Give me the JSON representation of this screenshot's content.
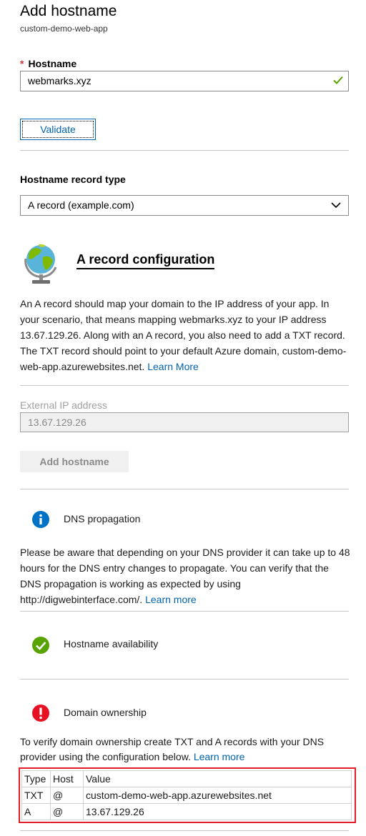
{
  "header": {
    "title": "Add hostname",
    "subtitle": "custom-demo-web-app"
  },
  "hostname": {
    "required_mark": "*",
    "label": "Hostname",
    "value": "webmarks.xyz",
    "valid": true
  },
  "validate_label": "Validate",
  "record_type": {
    "label": "Hostname record type",
    "selected": "A record (example.com)"
  },
  "config": {
    "title": "A record configuration",
    "description": "An A record should map your domain to the IP address of your app. In your scenario, that means mapping webmarks.xyz to your IP address 13.67.129.26. Along with an A record, you also need to add a TXT record. The TXT record should point to your default Azure domain, custom-demo-web-app.azurewebsites.net.",
    "learn_more": "Learn More"
  },
  "external_ip": {
    "label": "External IP address",
    "value": "13.67.129.26"
  },
  "add_hostname_label": "Add hostname",
  "dns_propagation": {
    "title": "DNS propagation",
    "description": "Please be aware that depending on your DNS provider it can take up to 48 hours for the DNS entry changes to propagate. You can verify that the DNS propagation is working as expected by using http://digwebinterface.com/.",
    "learn_more": "Learn more"
  },
  "hostname_availability": {
    "title": "Hostname availability"
  },
  "domain_ownership": {
    "title": "Domain ownership",
    "description": "To verify domain ownership create TXT and A records with your DNS provider using the configuration below.",
    "learn_more": "Learn more"
  },
  "records_table": {
    "headers": [
      "Type",
      "Host",
      "Value"
    ],
    "rows": [
      [
        "TXT",
        "@",
        "custom-demo-web-app.azurewebsites.net"
      ],
      [
        "A",
        "@",
        "13.67.129.26"
      ]
    ]
  },
  "colors": {
    "accent": "#0063b1",
    "success": "#57a300",
    "error": "#e81123",
    "info": "#0072c6",
    "highlight_border": "#e11e2a"
  }
}
